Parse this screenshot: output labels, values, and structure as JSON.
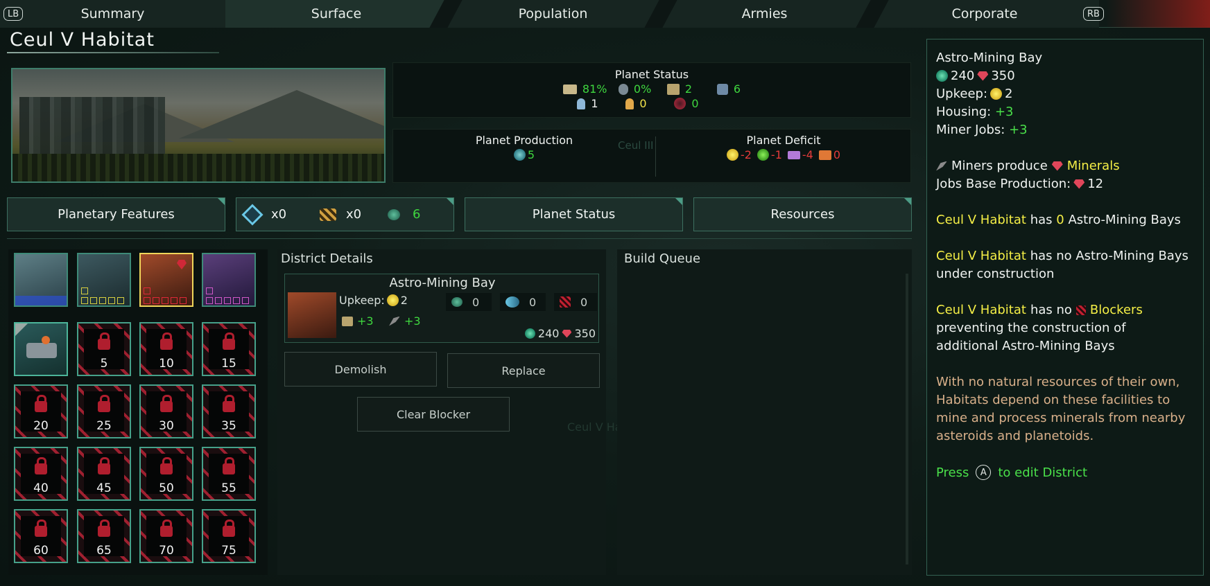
{
  "tabs": {
    "lb": "LB",
    "rb": "RB",
    "items": [
      "Summary",
      "Surface",
      "Population",
      "Armies",
      "Corporate"
    ],
    "active": "Surface"
  },
  "planet_name": "Ceul V Habitat",
  "planet_status": {
    "title": "Planet Status",
    "stability": "81%",
    "crime": "0%",
    "free_housing": "2",
    "amenities": "6",
    "unemployed": "1",
    "free_jobs": "0",
    "bio_deficit": "0"
  },
  "production": {
    "title": "Planet Production",
    "unity": "5"
  },
  "deficit": {
    "title": "Planet Deficit",
    "energy": "-2",
    "food": "-1",
    "consumer_goods": "-4",
    "trade": "0"
  },
  "background_label": "Ceul III",
  "toolbar": {
    "features": "Planetary Features",
    "item1": "x0",
    "item2": "x0",
    "item3": "6",
    "status": "Planet Status",
    "resources": "Resources"
  },
  "slots": [
    "5",
    "10",
    "15",
    "20",
    "25",
    "30",
    "35",
    "40",
    "45",
    "50",
    "55",
    "60",
    "65",
    "70",
    "75"
  ],
  "district_details": {
    "title": "District Details",
    "name": "Astro-Mining Bay",
    "upkeep_label": "Upkeep:",
    "upkeep": "2",
    "jobs1": "+3",
    "jobs2": "+3",
    "c1": "0",
    "c2": "0",
    "c3": "0",
    "cost_alloy": "240",
    "cost_mineral": "350",
    "demolish": "Demolish",
    "replace": "Replace",
    "clear": "Clear Blocker"
  },
  "faded_label": "Ceul V Habitat",
  "build_queue": {
    "title": "Build Queue"
  },
  "tooltip": {
    "title": "Astro-Mining Bay",
    "cost_alloy": "240",
    "cost_mineral": "350",
    "upkeep_label": "Upkeep:",
    "upkeep": "2",
    "housing_label": "Housing:",
    "housing": "+3",
    "jobs_label": "Miner Jobs:",
    "jobs": "+3",
    "miners_produce": "Miners produce",
    "minerals": "Minerals",
    "base_label": "Jobs Base Production:",
    "base": "12",
    "planet": "Ceul V Habitat",
    "has": "has",
    "count": "0",
    "bays_suffix": "Astro-Mining Bays",
    "no_bays": "has no Astro-Mining Bays",
    "under_construction": "under construction",
    "has_no": "has no",
    "blockers": "Blockers",
    "preventing": "preventing the construction of",
    "additional": "additional Astro-Mining Bays",
    "lore1": "With no natural resources of their own,",
    "lore2": "Habitats depend on these facilities to",
    "lore3": "mine and process minerals from nearby",
    "lore4": "asteroids and planetoids.",
    "press": "Press",
    "button": "A",
    "to_edit": "to edit District"
  },
  "colors": {
    "accent": "#3d7060",
    "positive": "#3fd73f",
    "negative": "#e43b3b",
    "highlight": "#f5ef46",
    "tooltip_title": "#f0a04a",
    "lore": "#d9b08a"
  }
}
